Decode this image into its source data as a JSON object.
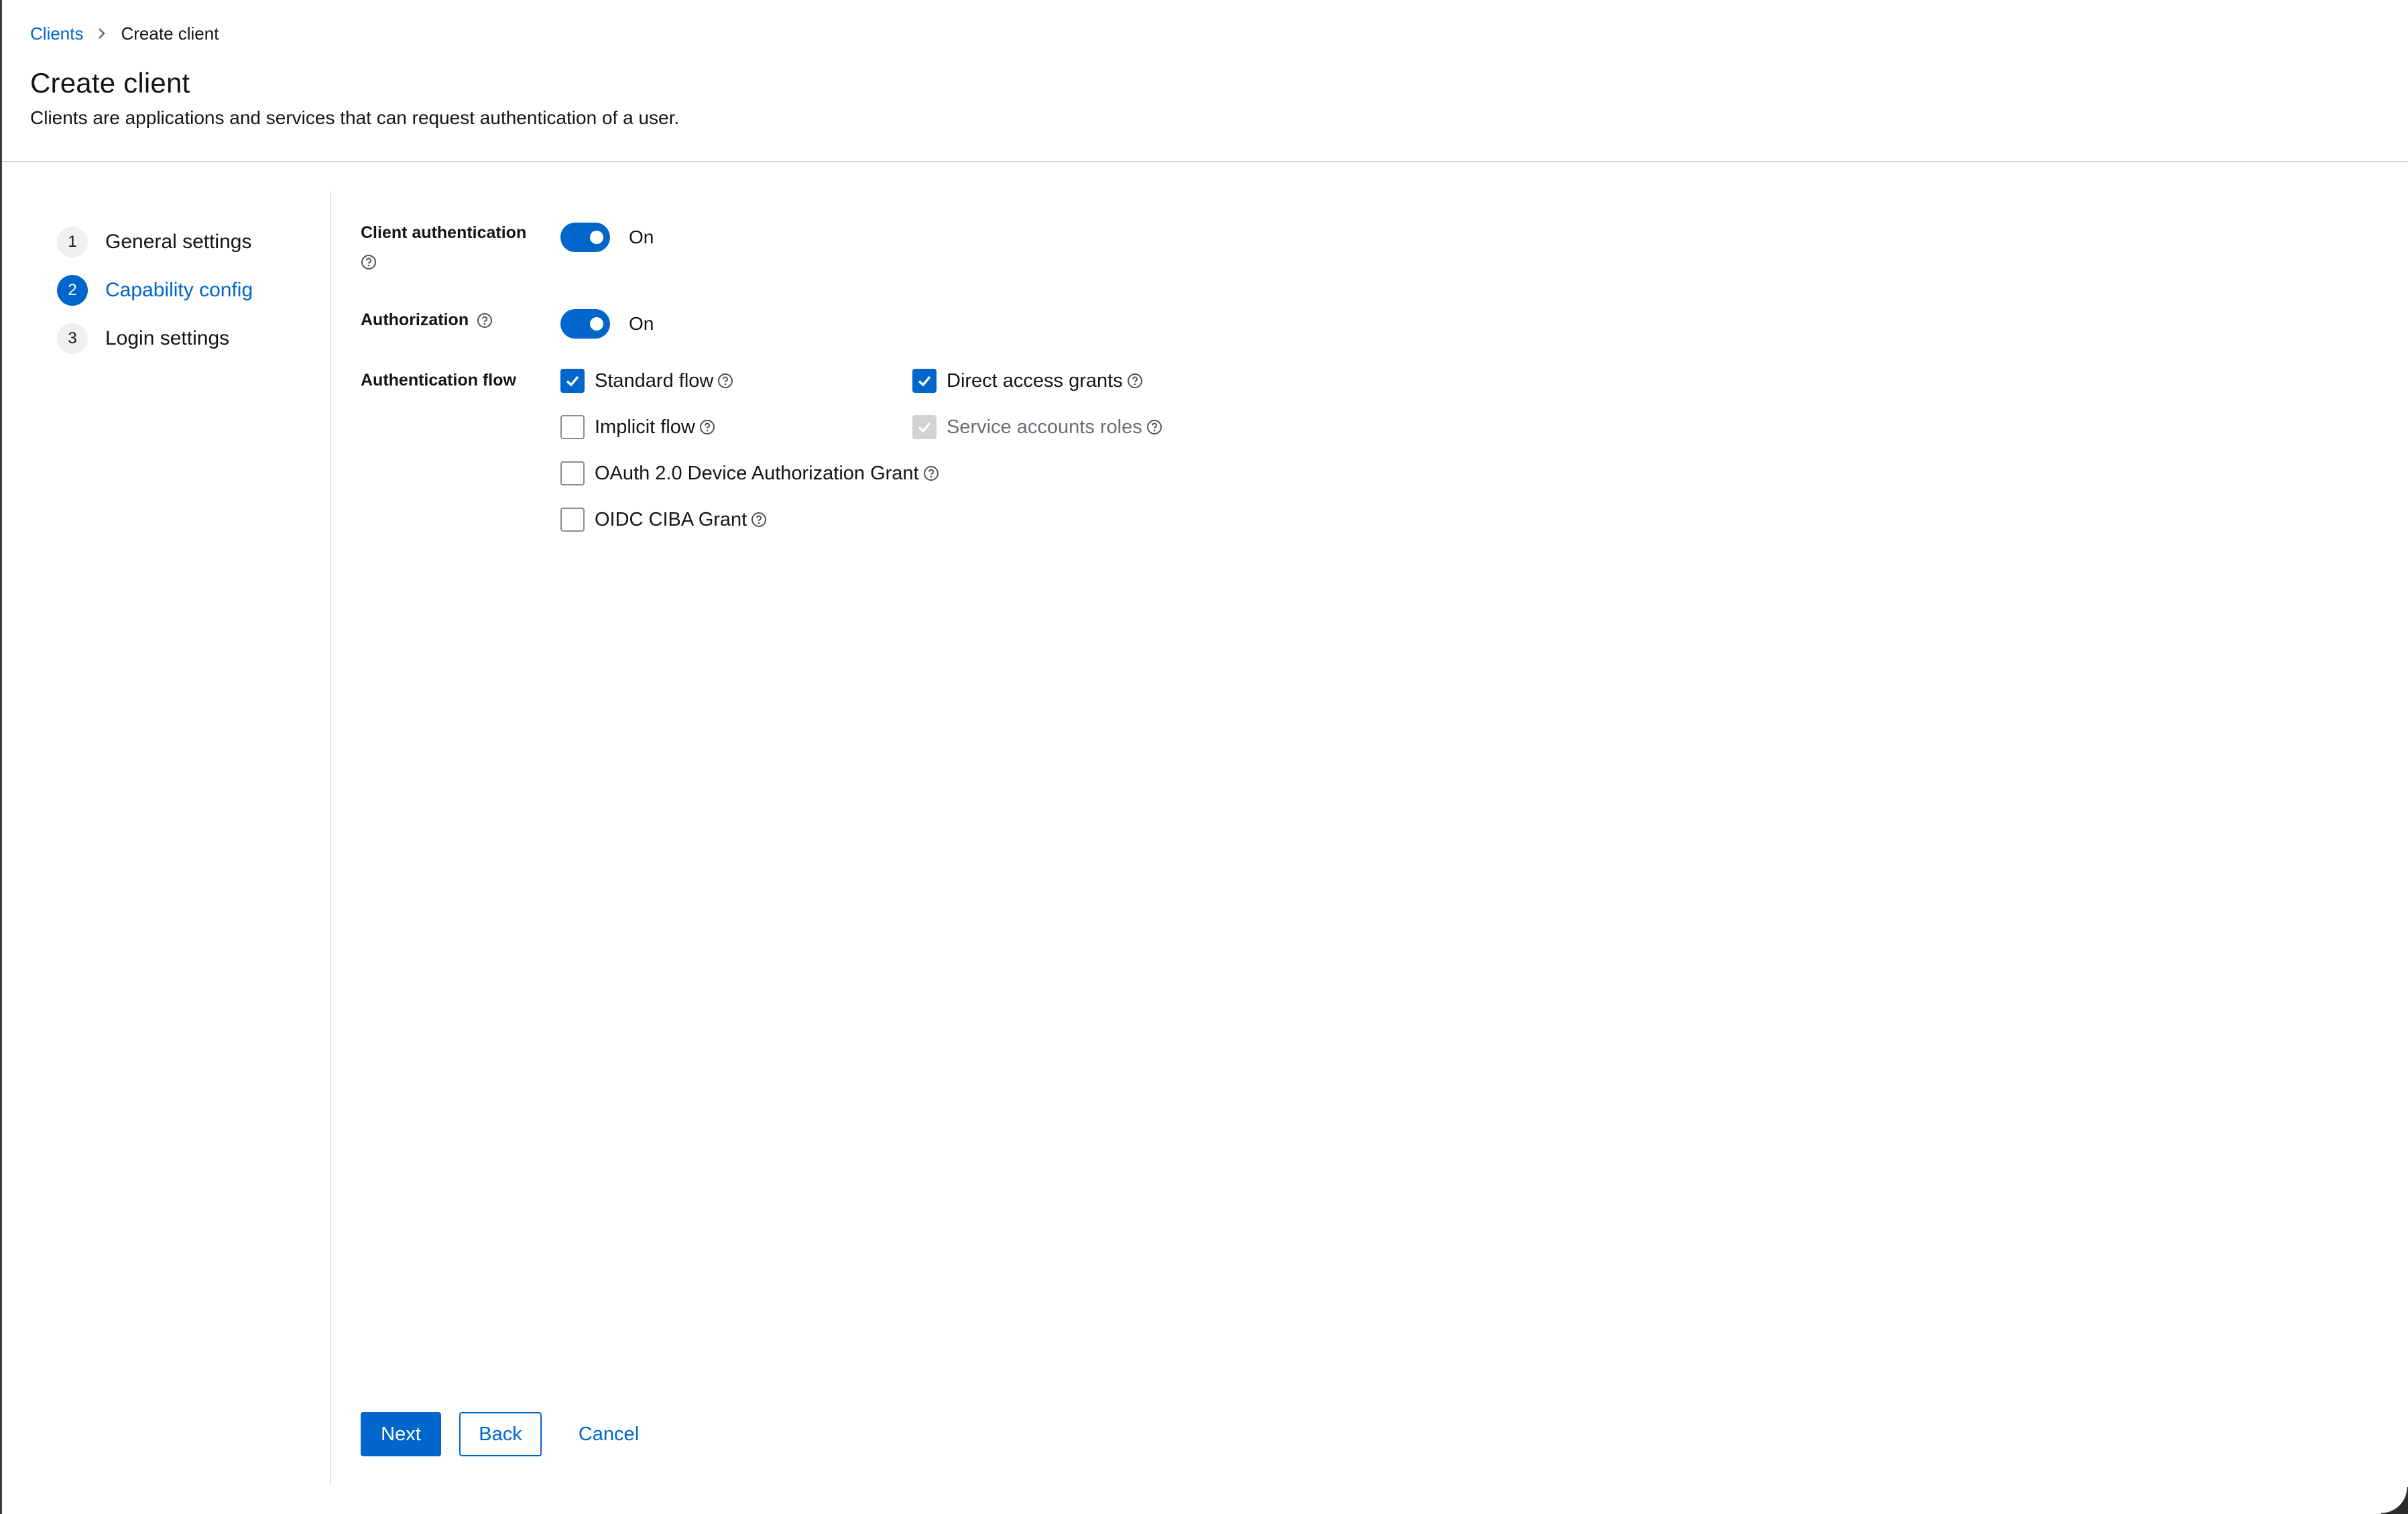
{
  "breadcrumb": {
    "parent": "Clients",
    "current": "Create client"
  },
  "header": {
    "title": "Create client",
    "description": "Clients are applications and services that can request authentication of a user."
  },
  "wizard": {
    "steps": [
      {
        "number": "1",
        "label": "General settings",
        "active": false
      },
      {
        "number": "2",
        "label": "Capability config",
        "active": true
      },
      {
        "number": "3",
        "label": "Login settings",
        "active": false
      }
    ]
  },
  "form": {
    "client_authentication": {
      "label": "Client authentication",
      "state": "On",
      "enabled": true
    },
    "authorization": {
      "label": "Authorization",
      "state": "On",
      "enabled": true
    },
    "authentication_flow": {
      "label": "Authentication flow",
      "options": {
        "standard_flow": {
          "label": "Standard flow",
          "checked": true,
          "disabled": false
        },
        "direct_access_grants": {
          "label": "Direct access grants",
          "checked": true,
          "disabled": false
        },
        "implicit_flow": {
          "label": "Implicit flow",
          "checked": false,
          "disabled": false
        },
        "service_accounts_roles": {
          "label": "Service accounts roles",
          "checked": true,
          "disabled": true
        },
        "oauth_device_grant": {
          "label": "OAuth 2.0 Device Authorization Grant",
          "checked": false,
          "disabled": false
        },
        "oidc_ciba_grant": {
          "label": "OIDC CIBA Grant",
          "checked": false,
          "disabled": false
        }
      }
    }
  },
  "footer": {
    "next_label": "Next",
    "back_label": "Back",
    "cancel_label": "Cancel"
  },
  "colors": {
    "primary": "#0066cc",
    "text": "#151515",
    "muted": "#6a6e73",
    "border": "#d2d2d2"
  },
  "icons": {
    "breadcrumb_separator": "chevron-right-icon",
    "help": "question-circle-icon",
    "checkmark": "check-icon"
  }
}
